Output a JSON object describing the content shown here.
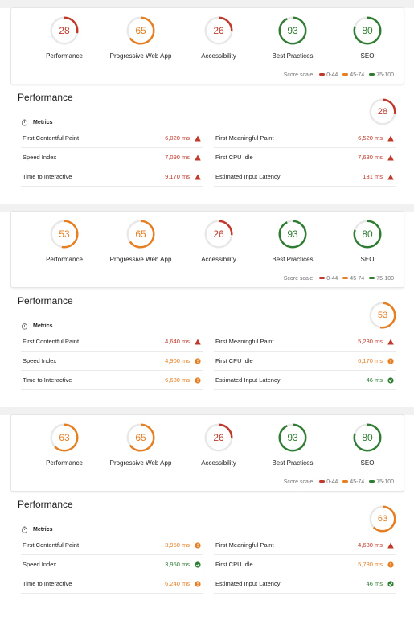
{
  "colors": {
    "fail": "#c0392b",
    "average": "#e67e22",
    "pass": "#2e7d32",
    "track": "#e8e8e8"
  },
  "scale": {
    "label": "Score scale:",
    "ranges": [
      "0-44",
      "45-74",
      "75-100"
    ]
  },
  "reports": [
    {
      "categories": [
        {
          "label": "Performance",
          "score": "28",
          "status": "fail"
        },
        {
          "label": "Progressive Web App",
          "score": "65",
          "status": "average"
        },
        {
          "label": "Accessibility",
          "score": "26",
          "status": "fail"
        },
        {
          "label": "Best Practices",
          "score": "93",
          "status": "pass"
        },
        {
          "label": "SEO",
          "score": "80",
          "status": "pass"
        }
      ],
      "performance": {
        "title": "Performance",
        "score": "28",
        "status": "fail",
        "metrics_header": "Metrics",
        "left": [
          {
            "label": "First Contentful Paint",
            "value": "6,020 ms",
            "status": "fail"
          },
          {
            "label": "Speed Index",
            "value": "7,090 ms",
            "status": "fail"
          },
          {
            "label": "Time to Interactive",
            "value": "9,170 ms",
            "status": "fail"
          }
        ],
        "right": [
          {
            "label": "First Meaningful Paint",
            "value": "6,520 ms",
            "status": "fail"
          },
          {
            "label": "First CPU Idle",
            "value": "7,630 ms",
            "status": "fail"
          },
          {
            "label": "Estimated Input Latency",
            "value": "131 ms",
            "status": "fail"
          }
        ]
      }
    },
    {
      "categories": [
        {
          "label": "Performance",
          "score": "53",
          "status": "average"
        },
        {
          "label": "Progressive Web App",
          "score": "65",
          "status": "average"
        },
        {
          "label": "Accessibility",
          "score": "26",
          "status": "fail"
        },
        {
          "label": "Best Practices",
          "score": "93",
          "status": "pass"
        },
        {
          "label": "SEO",
          "score": "80",
          "status": "pass"
        }
      ],
      "performance": {
        "title": "Performance",
        "score": "53",
        "status": "average",
        "metrics_header": "Metrics",
        "left": [
          {
            "label": "First Contentful Paint",
            "value": "4,640 ms",
            "status": "fail"
          },
          {
            "label": "Speed Index",
            "value": "4,900 ms",
            "status": "average"
          },
          {
            "label": "Time to Interactive",
            "value": "6,680 ms",
            "status": "average"
          }
        ],
        "right": [
          {
            "label": "First Meaningful Paint",
            "value": "5,230 ms",
            "status": "fail"
          },
          {
            "label": "First CPU Idle",
            "value": "6,170 ms",
            "status": "average"
          },
          {
            "label": "Estimated Input Latency",
            "value": "46 ms",
            "status": "pass"
          }
        ]
      }
    },
    {
      "categories": [
        {
          "label": "Performance",
          "score": "63",
          "status": "average"
        },
        {
          "label": "Progressive Web App",
          "score": "65",
          "status": "average"
        },
        {
          "label": "Accessibility",
          "score": "26",
          "status": "fail"
        },
        {
          "label": "Best Practices",
          "score": "93",
          "status": "pass"
        },
        {
          "label": "SEO",
          "score": "80",
          "status": "pass"
        }
      ],
      "performance": {
        "title": "Performance",
        "score": "63",
        "status": "average",
        "metrics_header": "Metrics",
        "left": [
          {
            "label": "First Contentful Paint",
            "value": "3,950 ms",
            "status": "average"
          },
          {
            "label": "Speed Index",
            "value": "3,950 ms",
            "status": "pass"
          },
          {
            "label": "Time to Interactive",
            "value": "6,240 ms",
            "status": "average"
          }
        ],
        "right": [
          {
            "label": "First Meaningful Paint",
            "value": "4,680 ms",
            "status": "fail"
          },
          {
            "label": "First CPU Idle",
            "value": "5,780 ms",
            "status": "average"
          },
          {
            "label": "Estimated Input Latency",
            "value": "46 ms",
            "status": "pass"
          }
        ]
      }
    }
  ]
}
